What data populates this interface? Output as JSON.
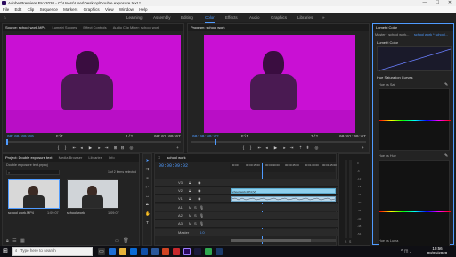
{
  "window": {
    "title": "Adobe Premiere Pro 2020 - C:\\Users\\User\\Desktop\\Double exposure text *",
    "controls": [
      "—",
      "☐",
      "✕"
    ]
  },
  "menu": [
    "File",
    "Edit",
    "Clip",
    "Sequence",
    "Markers",
    "Graphics",
    "View",
    "Window",
    "Help"
  ],
  "workspaces": [
    {
      "label": "Learning",
      "active": false
    },
    {
      "label": "Assembly",
      "active": false
    },
    {
      "label": "Editing",
      "active": false
    },
    {
      "label": "Color",
      "active": true
    },
    {
      "label": "Effects",
      "active": false
    },
    {
      "label": "Audio",
      "active": false
    },
    {
      "label": "Graphics",
      "active": false
    },
    {
      "label": "Libraries",
      "active": false
    }
  ],
  "source_panel": {
    "tabs": [
      "Source: school work.MP4",
      "Lumetri Scopes",
      "Effect Controls",
      "Audio Clip Mixer: school work"
    ],
    "timecode_in": "00:00:00:00",
    "fit": "Fit",
    "ratio": "1/2",
    "timecode_out": "00:01:09:07"
  },
  "program_panel": {
    "tabs": [
      "Program: school work"
    ],
    "timecode_in": "00:00:09:02",
    "fit": "Fit",
    "ratio": "1/2",
    "timecode_out": "00:01:09:07"
  },
  "lumetri": {
    "title": "Lumetri Color",
    "master": "Master * school work...",
    "clip": "school work * school...",
    "section": "Lumetri Color",
    "curves_label": "Hue Saturation Curves",
    "hue_sat": "Hue vs Sat",
    "hue_hue": "Hue vs Hue",
    "hue_luma": "Hue vs Luma"
  },
  "project": {
    "tabs": [
      "Project: Double exposure text",
      "Media Browser",
      "Libraries",
      "Info"
    ],
    "path": "Double exposure text.prproj",
    "selected": "1 of 2 items selected",
    "items": [
      {
        "name": "school work.MP4",
        "duration": "1:09:07"
      },
      {
        "name": "school work",
        "duration": "1:09:07"
      }
    ]
  },
  "timeline": {
    "tab": "school work",
    "timecode": "00:00:09:02",
    "ruler": [
      "00:00",
      "00:00:15:00",
      "00:00:30:00",
      "00:00:45:00",
      "00:01:00:00",
      "00:01:15:00"
    ],
    "video_tracks": [
      "V3",
      "V2",
      "V1"
    ],
    "audio_tracks": [
      "A1",
      "A2",
      "A3"
    ],
    "master_label": "Master",
    "master_value": "0.0",
    "clip_v": "school work.MP4 [V]",
    "clip_a": ""
  },
  "meter_scale": [
    "0",
    "-6",
    "-12",
    "-18",
    "-24",
    "-30",
    "-36",
    "-42",
    "-48",
    "-54"
  ],
  "meter_footer": [
    "S",
    "S"
  ],
  "taskbar": {
    "search_placeholder": "Type here to search",
    "time": "10:56",
    "date": "08/05/2020"
  },
  "colors": {
    "accent": "#4f9bff",
    "video_tint": "#c910d4",
    "clip_video": "#8fd0ee",
    "clip_audio": "#2b8a70"
  }
}
